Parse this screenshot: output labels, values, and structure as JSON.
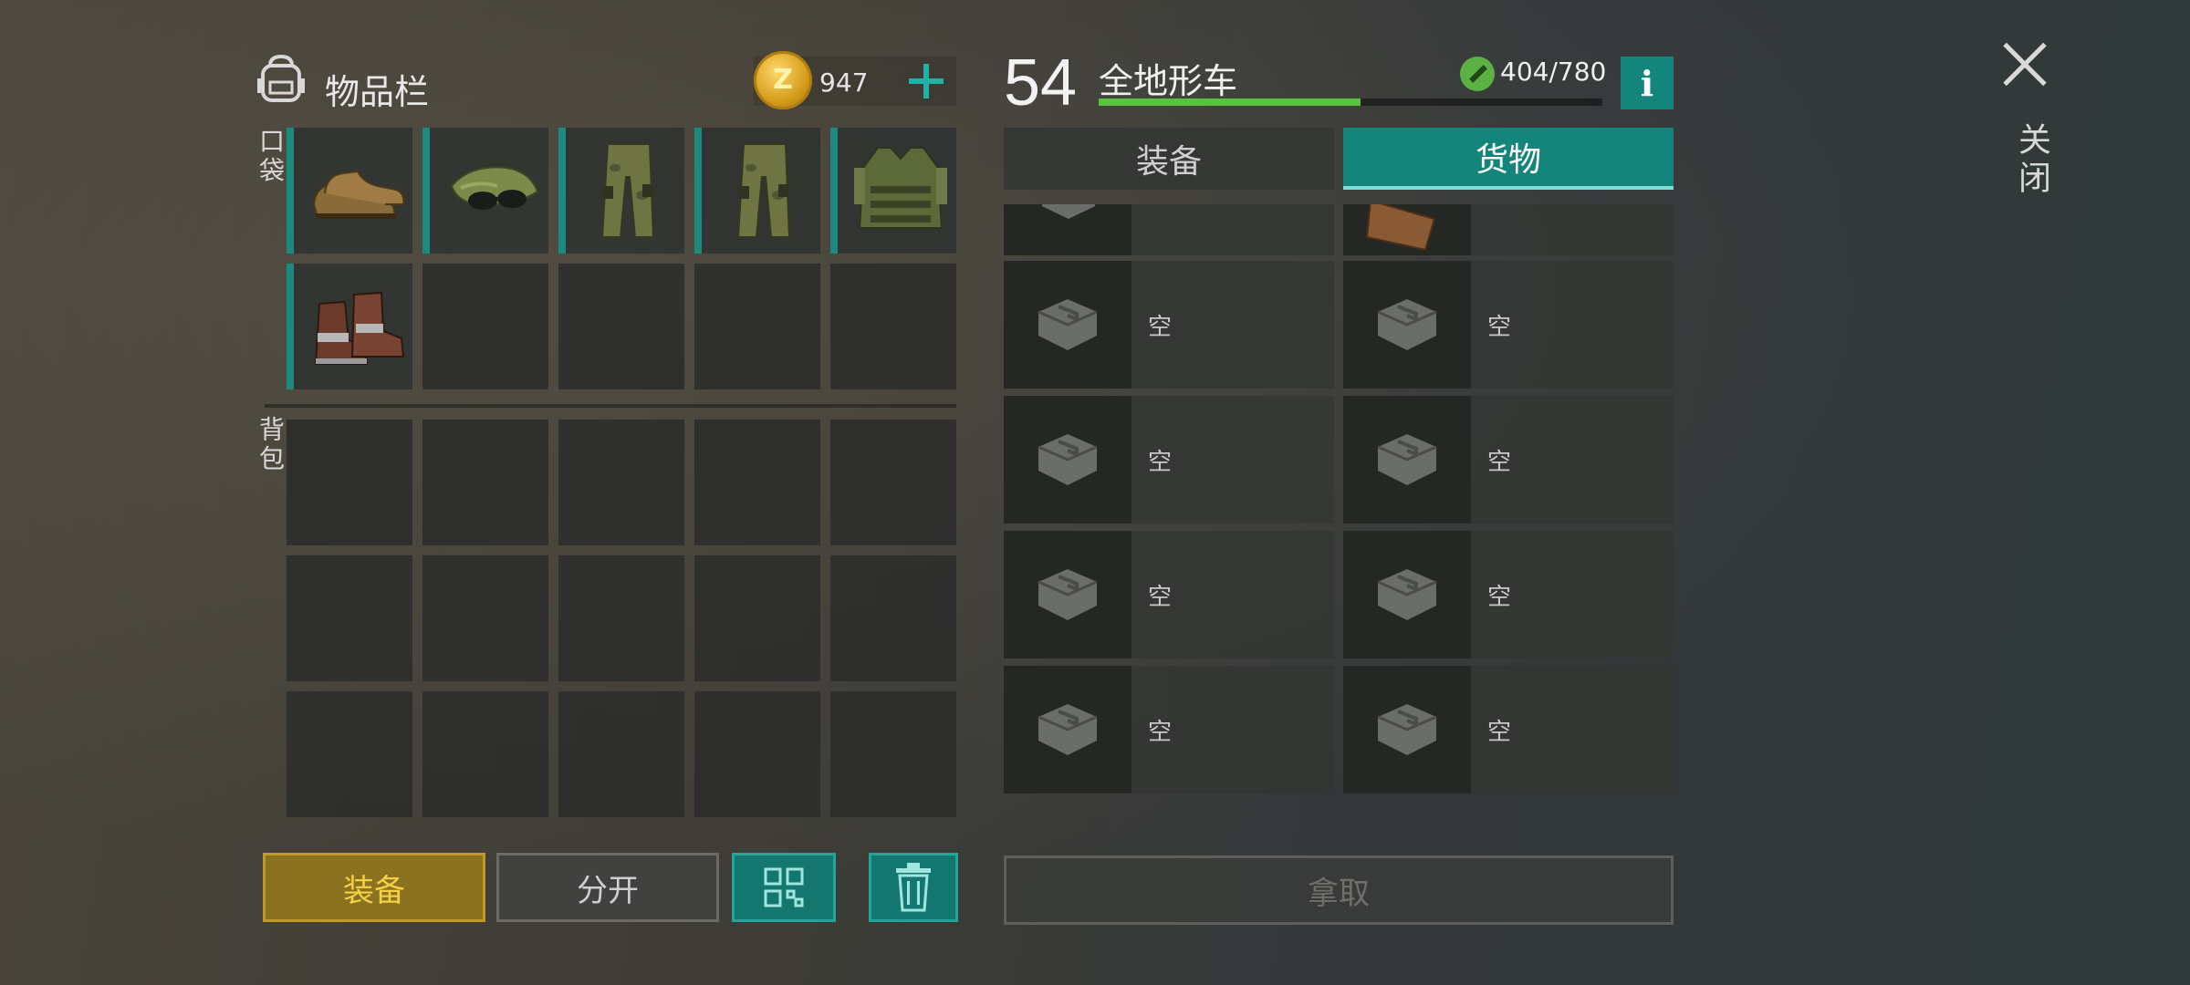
{
  "inventory": {
    "title": "物品栏",
    "coins": "947",
    "coin_icon_label": "Z",
    "pocket_label": "口袋",
    "backpack_label": "背包",
    "pocket_items": [
      "work-shoes-icon",
      "cap-with-sunglasses-icon",
      "camo-pants-icon",
      "camo-pants-icon",
      "tactical-vest-icon",
      "armored-boots-icon",
      "",
      "",
      "",
      ""
    ],
    "backpack_slots": 15
  },
  "buttons": {
    "equip": "装备",
    "split": "分开",
    "grid_icon": "grid-icon",
    "trash_icon": "trash-icon",
    "take": "拿取"
  },
  "vehicle": {
    "level": "54",
    "name": "全地形车",
    "durability": "404/780",
    "durability_fraction": 0.52,
    "info": "i"
  },
  "tabs": {
    "equipment": "装备",
    "cargo": "货物",
    "active": "cargo"
  },
  "cargo": {
    "empty_label": "空",
    "rows": [
      [
        "空",
        "空"
      ],
      [
        "空",
        "空"
      ],
      [
        "空",
        "空"
      ],
      [
        "空",
        "空"
      ]
    ]
  },
  "close": {
    "label": "关闭"
  },
  "colors": {
    "accent": "#14857b",
    "equip_gold": "#c19a23",
    "durability": "#58c43c"
  }
}
